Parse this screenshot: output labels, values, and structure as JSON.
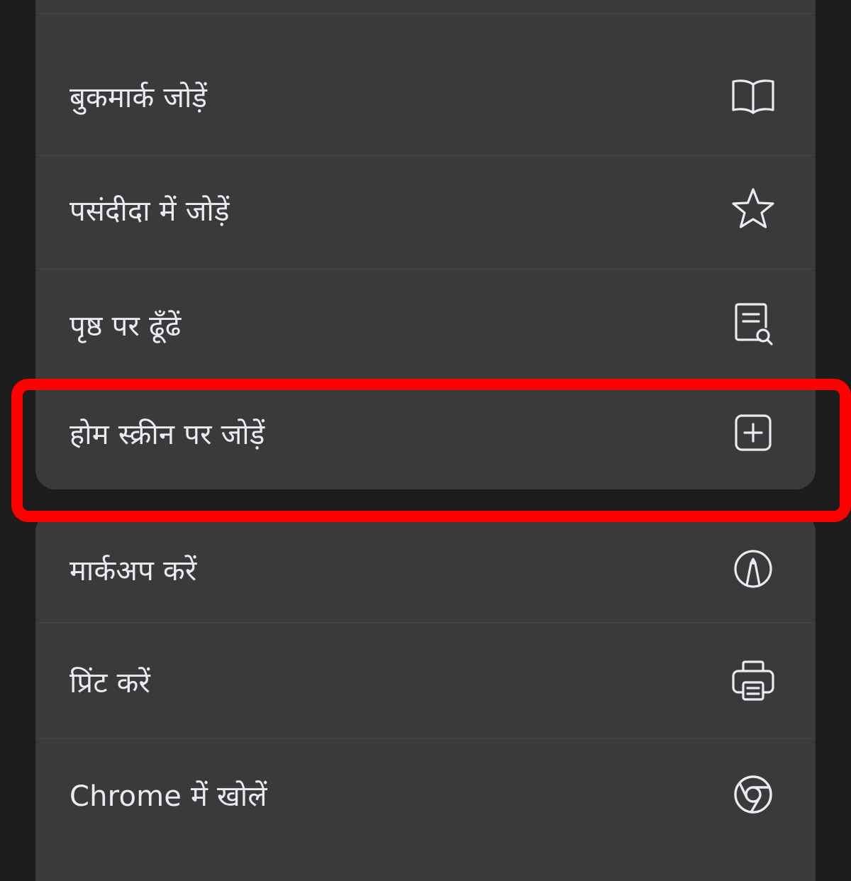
{
  "menu": {
    "group1": [
      {
        "label": "बुकमार्क जोड़ें",
        "icon": "book-icon"
      },
      {
        "label": "पसंदीदा में जोड़ें",
        "icon": "star-icon"
      },
      {
        "label": "पृष्ठ पर ढूँढें",
        "icon": "find-on-page-icon"
      },
      {
        "label": "होम स्क्रीन पर जोड़ें",
        "icon": "add-square-icon"
      }
    ],
    "group2": [
      {
        "label": "मार्कअप करें",
        "icon": "markup-pen-icon"
      },
      {
        "label": "प्रिंट करें",
        "icon": "printer-icon"
      },
      {
        "label": "Chrome में खोलें",
        "icon": "chrome-icon"
      }
    ]
  },
  "highlight": {
    "color": "#ff0000",
    "target": "होम स्क्रीन पर जोड़ें"
  }
}
